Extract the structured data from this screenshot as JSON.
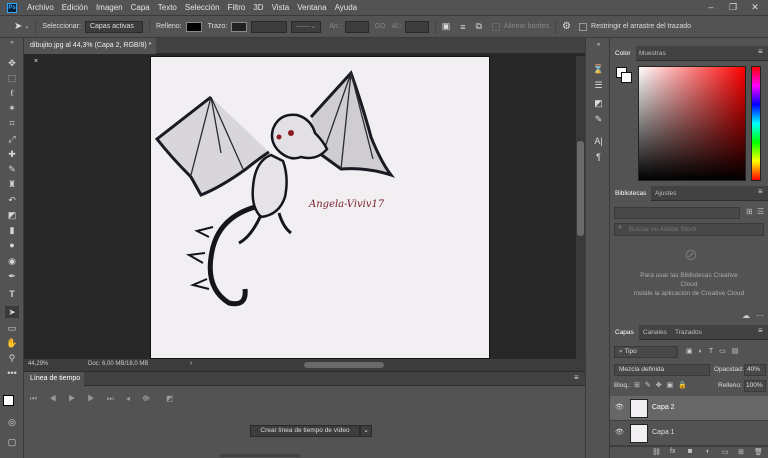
{
  "menubar": {
    "logo": "Ps",
    "items": [
      "Archivo",
      "Edición",
      "Imagen",
      "Capa",
      "Texto",
      "Selección",
      "Filtro",
      "3D",
      "Vista",
      "Ventana",
      "Ayuda"
    ],
    "window_controls": [
      "–",
      "❐",
      "✕"
    ]
  },
  "options": {
    "select_label": "Seleccionar:",
    "select_value": "Capas activas",
    "fill_label": "Relleno:",
    "stroke_label": "Trazo:",
    "w_label": "An.:",
    "link_symbol": "GO",
    "h_label": "Al.:",
    "align_edges": "Alinear bordes",
    "restrict_label": "Restringir el arrastre del trazado"
  },
  "document": {
    "tab_title": "dibujito.jpg al 44,3% (Capa 2, RGB/8) *",
    "close_symbol": "×",
    "zoom": "44,29%",
    "doc_info": "Doc: 6,00 MB/18,0 MB",
    "canvas_text": "Angela-Viviv17"
  },
  "timeline": {
    "title": "Línea de tiempo",
    "create_button": "Crear línea de tiempo de vídeo"
  },
  "color_panel": {
    "tabs": [
      "Color",
      "Muestras"
    ],
    "active_tab": "Color",
    "hue_color": "#ff0000"
  },
  "libraries_panel": {
    "tabs": [
      "Bibliotecas",
      "Ajustes"
    ],
    "active_tab": "Bibliotecas",
    "search_placeholder": "Buscar en Adobe Stock",
    "message_line1": "Para usar las Bibliotecas Creative",
    "message_line2": "Cloud",
    "message_line3": "instale la aplicación de Creative Cloud"
  },
  "layers_panel": {
    "tabs": [
      "Capas",
      "Canales",
      "Trazados"
    ],
    "active_tab": "Capas",
    "filter_value": "Tipo",
    "blend_mode": "Mezcla definida",
    "opacity_label": "Opacidad:",
    "opacity_value": "40%",
    "lock_label": "Bloq.:",
    "fill_label": "Relleno:",
    "fill_value": "100%",
    "layers": [
      {
        "name": "Capa 2",
        "selected": true
      },
      {
        "name": "Capa 1",
        "selected": false
      }
    ],
    "footer_icons": [
      "link-icon",
      "fx-icon",
      "mask-icon",
      "adjustment-icon",
      "group-icon",
      "new-layer-icon",
      "trash-icon"
    ]
  }
}
